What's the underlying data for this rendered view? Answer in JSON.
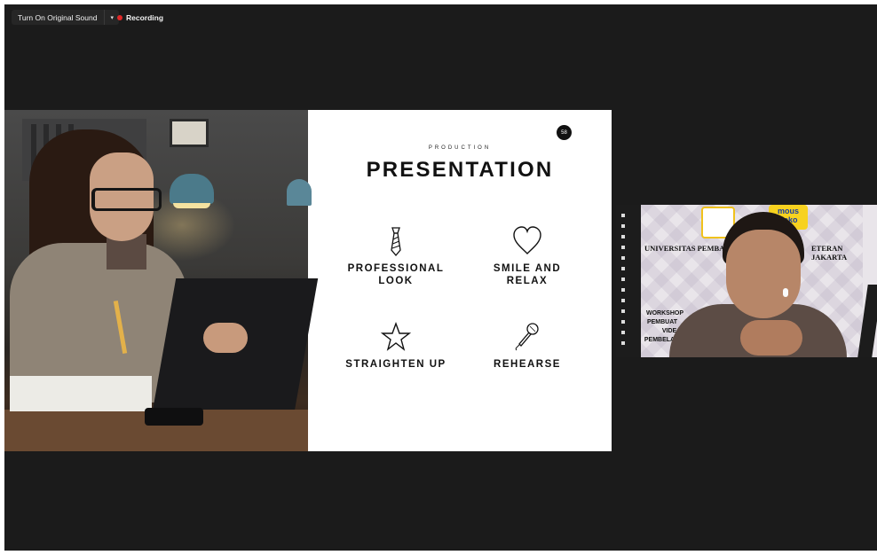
{
  "toolbar": {
    "sound_label": "Turn On Original Sound",
    "sound_chevron": "▾",
    "recording_label": "Recording",
    "recording_color": "#e02828"
  },
  "slide": {
    "number": "58",
    "kicker": "PRODUCTION",
    "title": "PRESENTATION",
    "items": [
      {
        "icon": "tie-icon",
        "line1": "PROFESSIONAL",
        "line2": "LOOK"
      },
      {
        "icon": "heart-icon",
        "line1": "SMILE AND",
        "line2": "RELAX"
      },
      {
        "icon": "star-icon",
        "line1": "STRAIGHTEN UP",
        "line2": ""
      },
      {
        "icon": "microphone-icon",
        "line1": "REHEARSE",
        "line2": ""
      }
    ]
  },
  "speaker": {
    "banner_left": "UNIVERSITAS PEMBA",
    "banner_right": "ETERAN JAKARTA",
    "logo_text_1": "mous",
    "logo_text_2": "deko",
    "workshop_lines": [
      "WORKSHOP",
      "PEMBUAT",
      "VIDE",
      "PEMBELA"
    ]
  }
}
